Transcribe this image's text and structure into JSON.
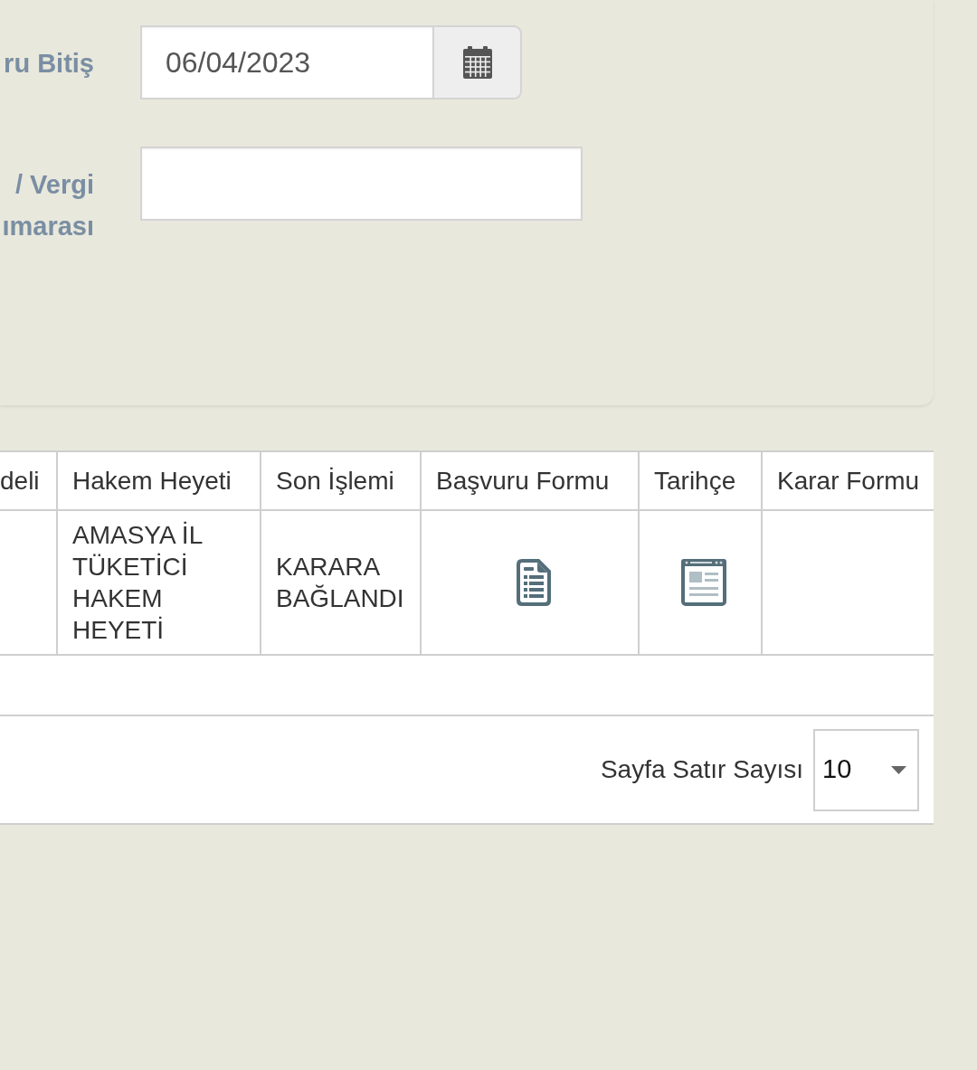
{
  "filter_form": {
    "fields": [
      {
        "kind": "date",
        "label": "ru Bitiş",
        "value": "06/04/2023"
      },
      {
        "kind": "text",
        "label": "/ Vergi ımarası"
      }
    ]
  },
  "table": {
    "columns": [
      "deli",
      "Hakem Heyeti",
      "Son İşlemi",
      "Başvuru Formu",
      "Tarihçe",
      "Karar Formu"
    ],
    "rows": [
      {
        "cells": [
          {
            "kind": "blank"
          },
          {
            "kind": "text",
            "text": "AMASYA İL TÜKETİCİ HAKEM HEYETİ"
          },
          {
            "kind": "text",
            "text": "KARARA BAĞLANDI"
          },
          {
            "kind": "form_link"
          },
          {
            "kind": "history_link"
          },
          {
            "kind": "blank"
          }
        ]
      }
    ],
    "page_size": {
      "label": "Sayfa Satır Sayısı",
      "value": "10"
    }
  }
}
